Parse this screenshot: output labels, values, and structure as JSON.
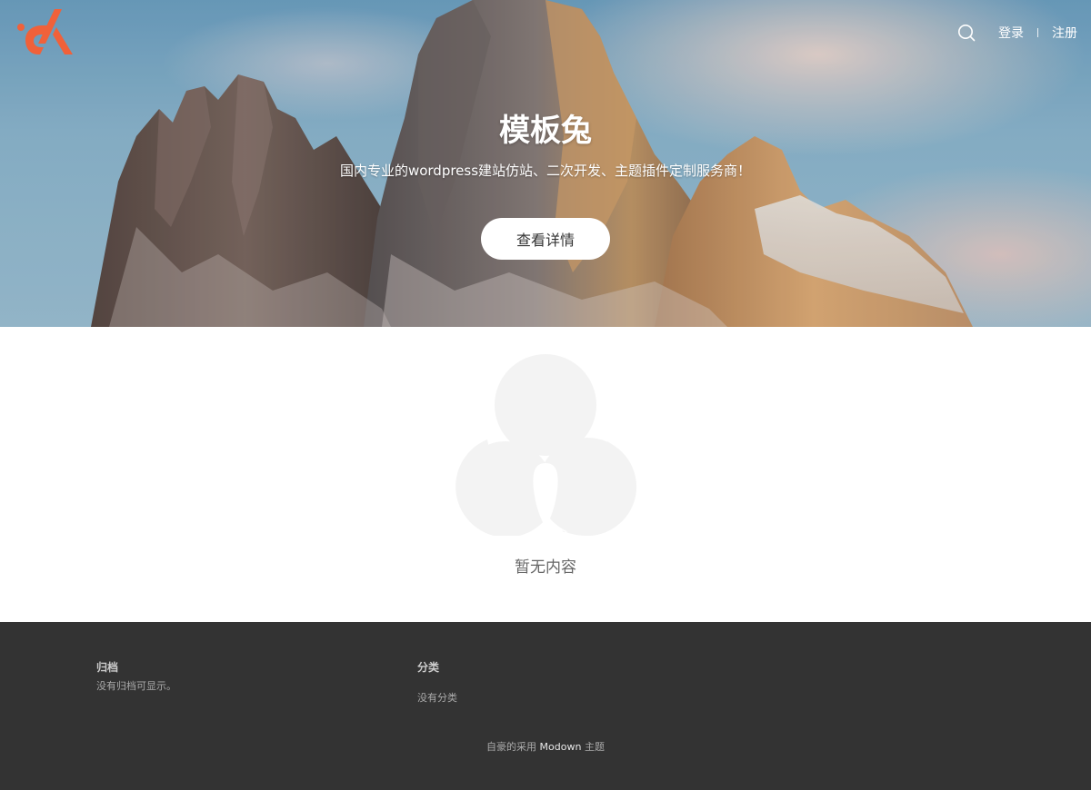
{
  "header": {
    "logo_icon": "brand-logo",
    "search_icon": "search-icon",
    "login_label": "登录",
    "register_label": "注册"
  },
  "hero": {
    "title": "模板兔",
    "subtitle": "国内专业的wordpress建站仿站、二次开发、主题插件定制服务商！",
    "button_label": "查看详情"
  },
  "empty_state": {
    "icon": "empty-content-icon",
    "message": "暂无内容"
  },
  "footer": {
    "archives": {
      "title": "归档",
      "empty_text": "没有归档可显示。"
    },
    "categories": {
      "title": "分类",
      "empty_text": "没有分类"
    },
    "credit": {
      "prefix": "自豪的采用",
      "theme_name": "Modown",
      "suffix": "主题"
    }
  },
  "colors": {
    "brand": "#f0613a",
    "footer_bg": "#333333",
    "illustration": "#f3f3f3"
  }
}
